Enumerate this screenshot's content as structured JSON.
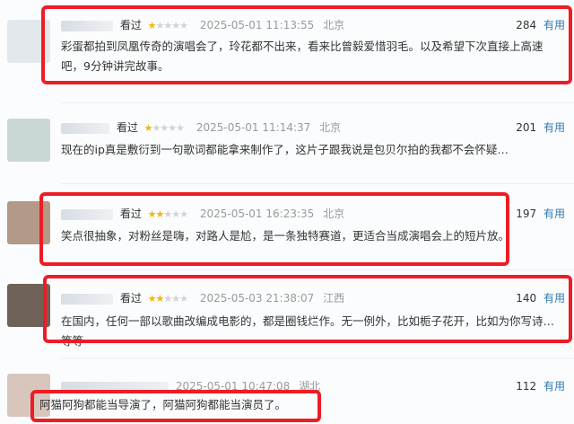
{
  "comments": [
    {
      "rating_label": "看过",
      "stars_on": "★",
      "stars_off": "★★★★",
      "time": "2025-05-01 11:13:55",
      "location": "北京",
      "votes": "284",
      "useful": "有用",
      "text": "彩蛋都拍到凤凰传奇的演唱会了，玲花都不出来，看来比曾毅爱惜羽毛。以及希望下次直接上高速吧，9分钟讲完故事。",
      "avatar_color": "#e3e8ec"
    },
    {
      "rating_label": "看过",
      "stars_on": "★",
      "stars_off": "★★★★",
      "time": "2025-05-01 11:14:37",
      "location": "北京",
      "votes": "201",
      "useful": "有用",
      "text": "现在的ip真是敷衍到一句歌词都能拿来制作了，这片子跟我说是包贝尔拍的我都不会怀疑…",
      "avatar_color": "#c9d8d4"
    },
    {
      "rating_label": "看过",
      "stars_on": "★★",
      "stars_off": "★★★",
      "time": "2025-05-01 16:23:35",
      "location": "北京",
      "votes": "197",
      "useful": "有用",
      "text": "笑点很抽象，对粉丝是嗨，对路人是尬，是一条独特赛道，更适合当成演唱会上的短片放。",
      "avatar_color": "#b39a88"
    },
    {
      "rating_label": "看过",
      "stars_on": "★★",
      "stars_off": "★★★",
      "time": "2025-05-03 21:38:07",
      "location": "江西",
      "votes": "140",
      "useful": "有用",
      "text": "在国内，任何一部以歌曲改编成电影的，都是圈钱烂作。无一例外，比如栀子花开，比如为你写诗…等等",
      "avatar_color": "#6e6258"
    },
    {
      "rating_label": "",
      "stars_on": "",
      "stars_off": "",
      "time": "2025-05-01 10:47:08",
      "location": "湖北",
      "votes": "112",
      "useful": "有用",
      "text": "阿猫阿狗都能当导演了，阿猫阿狗都能当演员了。",
      "avatar_color": "#d8c6bd"
    }
  ],
  "highlight_color": "#ee1c25"
}
